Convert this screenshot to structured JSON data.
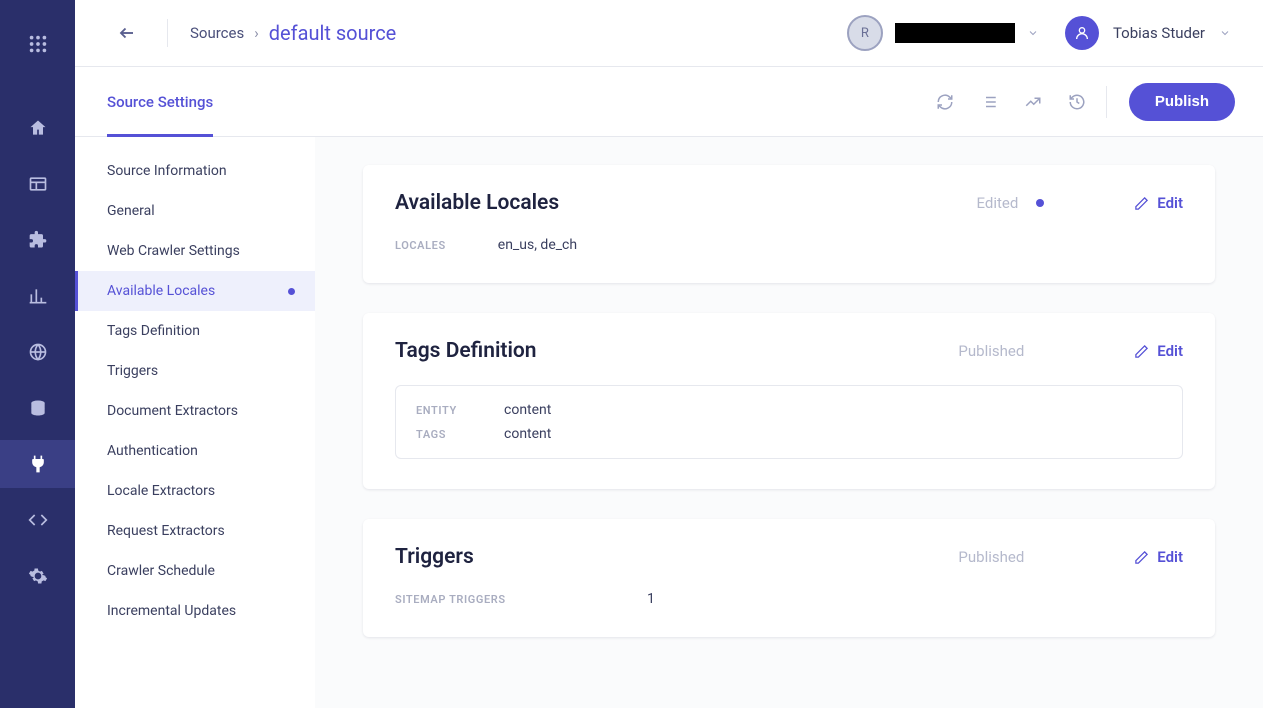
{
  "rail": {
    "items": [
      "apps",
      "home",
      "layout",
      "puzzle",
      "chart",
      "globe",
      "database",
      "plug",
      "code",
      "gear"
    ],
    "active_index": 7
  },
  "breadcrumb": {
    "root": "Sources",
    "current": "default source"
  },
  "org": {
    "initial": "R"
  },
  "user": {
    "name": "Tobias Studer"
  },
  "tabs": {
    "active": "Source Settings"
  },
  "actions": {
    "publish": "Publish"
  },
  "subnav": {
    "items": [
      "Source Information",
      "General",
      "Web Crawler Settings",
      "Available Locales",
      "Tags Definition",
      "Triggers",
      "Document Extractors",
      "Authentication",
      "Locale Extractors",
      "Request Extractors",
      "Crawler Schedule",
      "Incremental Updates"
    ],
    "active_index": 3,
    "dotted_index": 3
  },
  "cards": {
    "locales": {
      "title": "Available Locales",
      "status": "Edited",
      "has_dot": true,
      "edit": "Edit",
      "label": "LOCALES",
      "value": "en_us, de_ch"
    },
    "tags": {
      "title": "Tags Definition",
      "status": "Published",
      "edit": "Edit",
      "rows": [
        {
          "label": "ENTITY",
          "value": "content"
        },
        {
          "label": "TAGS",
          "value": "content"
        }
      ]
    },
    "triggers": {
      "title": "Triggers",
      "status": "Published",
      "edit": "Edit",
      "label": "SITEMAP TRIGGERS",
      "value": "1"
    }
  }
}
